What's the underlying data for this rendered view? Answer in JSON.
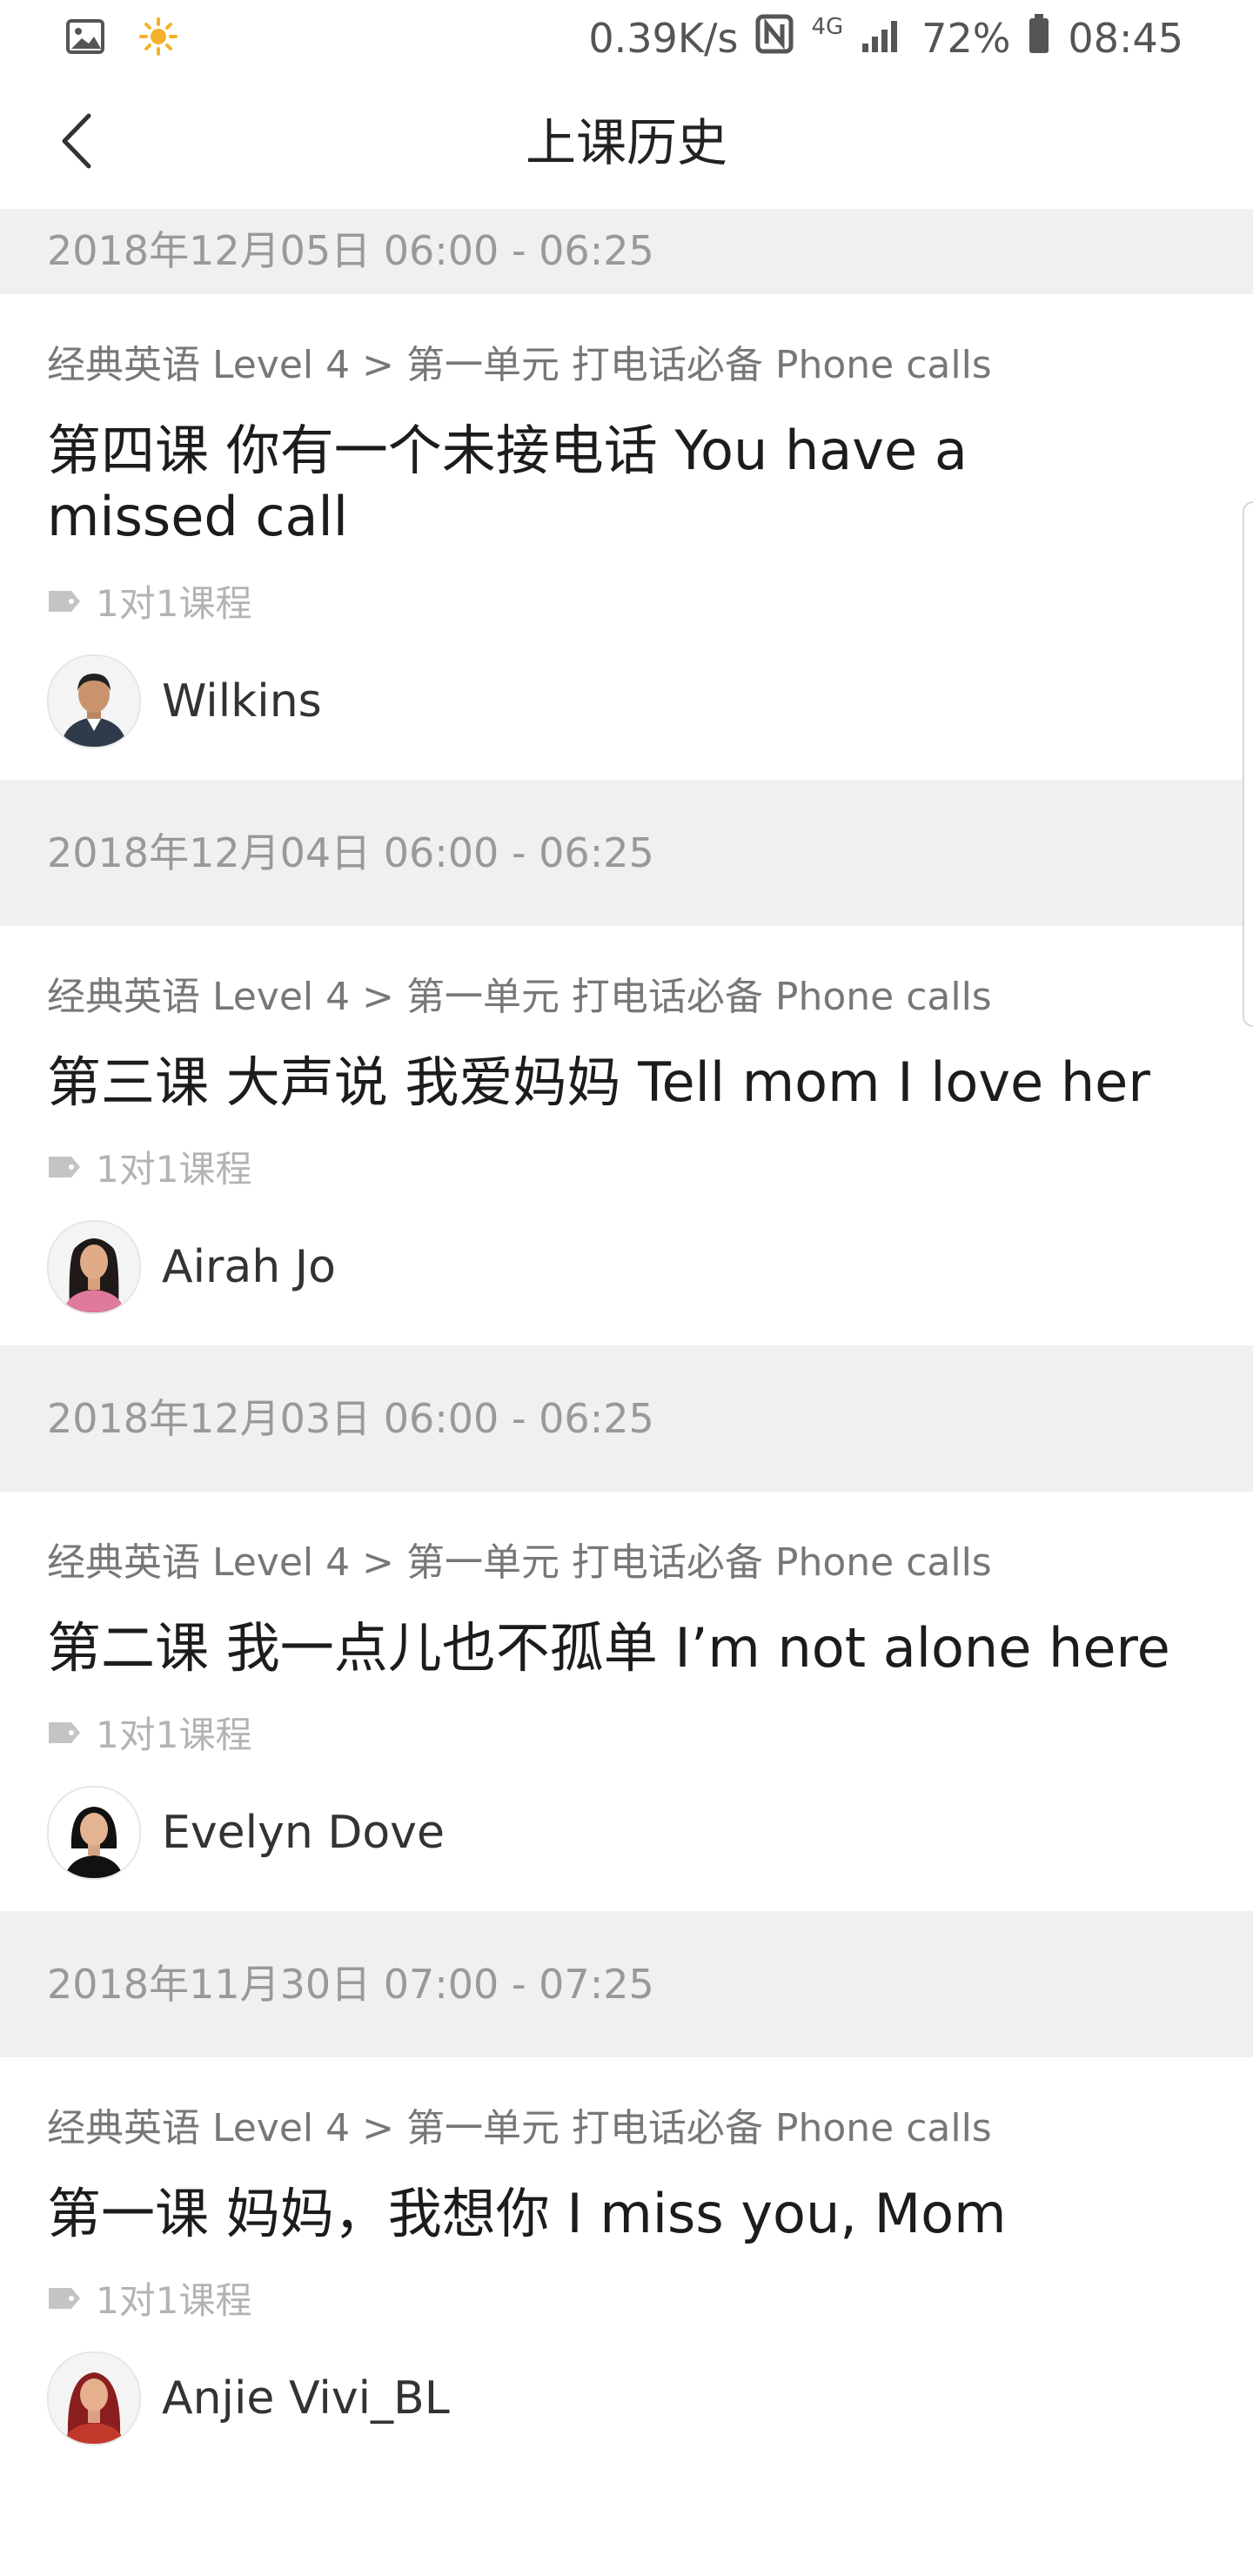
{
  "status_bar": {
    "net_speed": "0.39K/s",
    "network": "4G",
    "battery": "72%",
    "time": "08:45",
    "icons": [
      "gallery-icon",
      "weather-icon",
      "nfc-icon",
      "signal-icon",
      "battery-icon"
    ]
  },
  "nav": {
    "title": "上课历史",
    "back_icon": "chevron-left-icon"
  },
  "records": [
    {
      "date": "2018年12月05日 06:00 - 06:25",
      "breadcrumb": "经典英语 Level 4 > 第一单元 打电话必备 Phone calls",
      "title": "第四课 你有一个未接电话 You have a missed call",
      "tag": "1对1课程",
      "teacher": "Wilkins"
    },
    {
      "date": "2018年12月04日 06:00 - 06:25",
      "breadcrumb": "经典英语 Level 4 > 第一单元 打电话必备 Phone calls",
      "title": "第三课 大声说 我爱妈妈 Tell mom I love her",
      "tag": "1对1课程",
      "teacher": "Airah Jo"
    },
    {
      "date": "2018年12月03日 06:00 - 06:25",
      "breadcrumb": "经典英语 Level 4 > 第一单元 打电话必备 Phone calls",
      "title": "第二课 我一点儿也不孤单 I’m not alone here",
      "tag": "1对1课程",
      "teacher": "Evelyn Dove"
    },
    {
      "date": "2018年11月30日 07:00 - 07:25",
      "breadcrumb": "经典英语 Level 4 > 第一单元 打电话必备 Phone calls",
      "title": "第一课 妈妈，我想你 I miss you, Mom",
      "tag": "1对1课程",
      "teacher": "Anjie Vivi_BL"
    }
  ],
  "colors": {
    "section_bg": "#f0f0f0",
    "muted_text": "#999999",
    "tag_text": "#b3b3b3"
  }
}
